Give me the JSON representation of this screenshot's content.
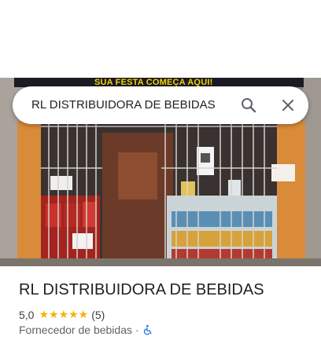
{
  "search": {
    "query": "RL DISTRIBUIDORA DE BEBIDAS"
  },
  "photo": {
    "banner_text": "SUA FESTA COMEÇA AQUI!"
  },
  "place": {
    "name": "RL DISTRIBUIDORA DE BEBIDAS",
    "rating": "5,0",
    "stars": "★★★★★",
    "review_count": "(5)",
    "category": "Fornecedor de bebidas",
    "separator": "·"
  },
  "icons": {
    "search": "search-icon",
    "close": "close-icon",
    "accessibility": "wheelchair-icon"
  },
  "colors": {
    "star": "#f4b400",
    "accessibility": "#1a73e8"
  }
}
